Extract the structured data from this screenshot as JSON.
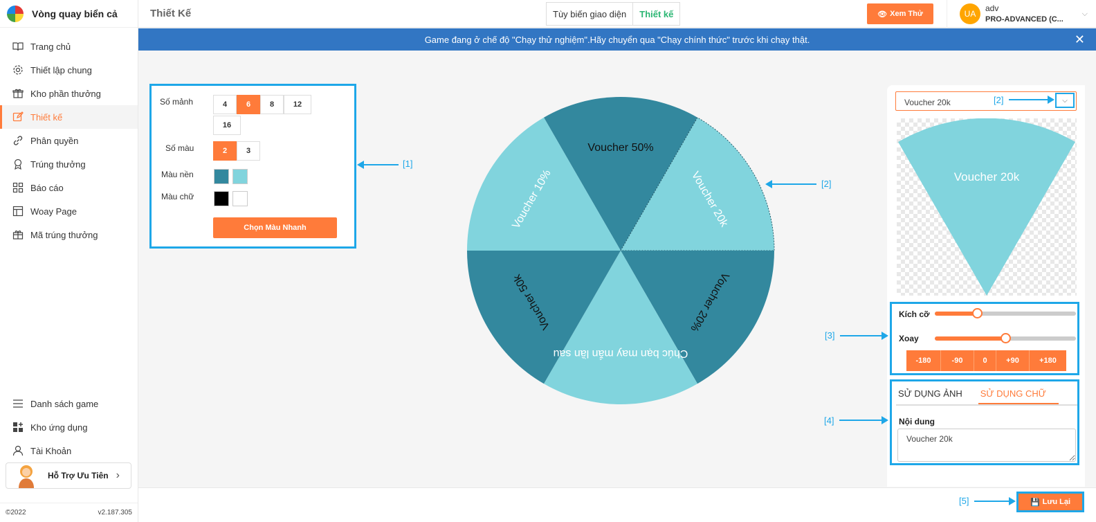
{
  "app": {
    "name": "Vòng quay biển cả"
  },
  "sidebar": {
    "items": [
      {
        "label": "Trang chủ"
      },
      {
        "label": "Thiết lập chung"
      },
      {
        "label": "Kho phần thưởng"
      },
      {
        "label": "Thiết kế"
      },
      {
        "label": "Phân quyền"
      },
      {
        "label": "Trúng thưởng"
      },
      {
        "label": "Báo cáo"
      },
      {
        "label": "Woay Page"
      },
      {
        "label": "Mã trúng thưởng"
      }
    ],
    "bottom_items": [
      {
        "label": "Danh sách game"
      },
      {
        "label": "Kho ứng dụng"
      },
      {
        "label": "Tài Khoản"
      }
    ],
    "support_label": "Hỗ Trợ Ưu Tiên",
    "copyright": "©2022",
    "version": "v2.187.305"
  },
  "header": {
    "title": "Thiết Kế",
    "tabs": [
      {
        "label": "Tùy biến giao diện"
      },
      {
        "label": "Thiết kế"
      }
    ],
    "preview_label": "Xem Thử",
    "user": {
      "initials": "UA",
      "name": "adv",
      "plan": "PRO-ADVANCED (C..."
    }
  },
  "banner": {
    "text": "Game đang ở chế độ \"Chạy thử nghiệm\".Hãy chuyển qua \"Chạy chính thức\" trước khi chạy thật."
  },
  "settings": {
    "segments_label": "Số mảnh",
    "segments": [
      "4",
      "6",
      "8",
      "12",
      "16"
    ],
    "segments_selected": "6",
    "colors_label": "Số màu",
    "colors": [
      "2",
      "3"
    ],
    "colors_selected": "2",
    "bg_label": "Màu nền",
    "bg_colors": [
      "#33889e",
      "#81d4dd"
    ],
    "text_label": "Màu chữ",
    "text_colors": [
      "#000000",
      "#ffffff"
    ],
    "quick_button": "Chọn Màu Nhanh"
  },
  "wheel": {
    "segments": [
      {
        "label": "Voucher 50%",
        "color": "#33889e",
        "text_color": "#111111"
      },
      {
        "label": "Voucher 20k",
        "color": "#81d4dd",
        "text_color": "#ffffff"
      },
      {
        "label": "Voucher 20%",
        "color": "#33889e",
        "text_color": "#111111"
      },
      {
        "label": "Chúc bạn may mắn lần sau",
        "color": "#81d4dd",
        "text_color": "#ffffff"
      },
      {
        "label": "Voucher 50k",
        "color": "#33889e",
        "text_color": "#111111"
      },
      {
        "label": "Voucher 10%",
        "color": "#81d4dd",
        "text_color": "#ffffff"
      }
    ]
  },
  "editor": {
    "selected_segment": "Voucher 20k",
    "preview_text": "Voucher 20k",
    "preview_color": "#81d4dd",
    "size_label": "Kích cỡ",
    "size_value": 0.3,
    "rotate_label": "Xoay",
    "rotate_value": 0.5,
    "rotate_buttons": [
      "-180",
      "-90",
      "0",
      "+90",
      "+180"
    ],
    "tab_image": "SỬ DỤNG ẢNH",
    "tab_text": "SỬ DỤNG CHỮ",
    "content_label": "Nội dung",
    "content_value": "Voucher 20k"
  },
  "annotations": {
    "a1": "[1]",
    "a2": "[2]",
    "a2b": "[2]",
    "a3": "[3]",
    "a4": "[4]",
    "a5": "[5]"
  },
  "footer": {
    "save_label": "Lưu Lại"
  }
}
